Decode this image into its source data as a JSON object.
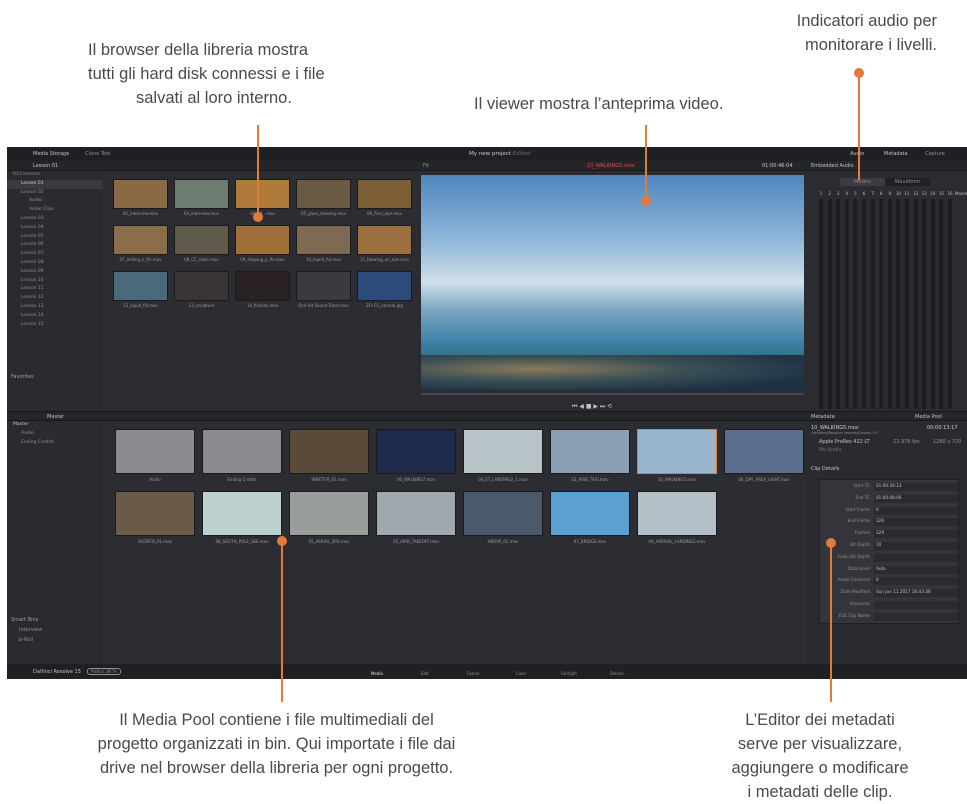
{
  "annotations": {
    "library": [
      "Il browser della libreria mostra",
      "tutti gli hard disk connessi e i file",
      "salvati al loro interno."
    ],
    "viewer": "Il viewer mostra l’anteprima video.",
    "audio": [
      "Indicatori audio per",
      "monitorare i livelli."
    ],
    "mediapool": [
      "Il Media Pool contiene i file multimediali del",
      "progetto organizzati in bin. Qui importate i file dai",
      "drive nel browser della libreria per ogni progetto."
    ],
    "metadata": [
      "L’Editor dei metadati",
      "serve per visualizzare,",
      "aggiungere o modificare",
      "i metadati delle clip."
    ]
  },
  "topbar": {
    "media_storage": "Media Storage",
    "clone_tool": "Clone Tool",
    "project": "My new project",
    "project_status": "Edited",
    "audio": "Audio",
    "metadata": "Metadata",
    "capture": "Capture"
  },
  "library": {
    "current": "Lesson 01",
    "tree": [
      "R15 lessons",
      "Lesson 01",
      "Lesson 02",
      "Audio",
      "Video Clips",
      "Lesson 03",
      "Lesson 04",
      "Lesson 05",
      "Lesson 06",
      "Lesson 07",
      "Lesson 08",
      "Lesson 09",
      "Lesson 10",
      "Lesson 11",
      "Lesson 12",
      "Lesson 13",
      "Lesson 14",
      "Lesson 15"
    ],
    "favorites": "Favorites",
    "clips": [
      "02_interview.mov",
      "03_interview.mov",
      "04_ad...mov",
      "05_glass_blowing.mov",
      "06_final_eye.mov",
      "07_milling_o_fin.mov",
      "08_CC_roots.mov",
      "09_shaping_p_fin.mov",
      "10_liquid_ful.mov",
      "11_blowing_on_eye.mov",
      "12_liquid_fill.mov",
      "13_sculpture",
      "14_finalize.mov",
      "One Hit Sound Track.mov",
      "ZFI-CC_normal.jpg"
    ]
  },
  "viewer": {
    "clip_name": "10_WALKING5.mov",
    "timecode": "01:00:46:04",
    "zoom": "Fit"
  },
  "audio_panel": {
    "title": "Embedded Audio",
    "tab_meters": "Meters",
    "tab_waveform": "Waveform",
    "channels": [
      "1",
      "2",
      "3",
      "4",
      "5",
      "6",
      "7",
      "8",
      "9",
      "10",
      "11",
      "12",
      "13",
      "14",
      "15",
      "16"
    ],
    "monitor": "Monitor"
  },
  "mediapool": {
    "bin": "Master",
    "bins": [
      "Master",
      "Audio",
      "Ending Credits"
    ],
    "smart_bins": "Smart Bins",
    "smart_items": [
      "Interview",
      "b-Roll"
    ],
    "clips": [
      "Audio",
      "Ending Credits",
      "INNETT-B_01.mov",
      "06_WALKING7.mov",
      "04_ET_LANDING2_1.mov",
      "03_AIRB_TAXI.mov",
      "10_WALKING5.mov",
      "06_DAY_AREA_LIGHT.mov",
      "SCENT-B_01.mov",
      "08_SOUTH_POLE_SEE.mov",
      "05_AERIAL_SRS.mov",
      "02_AIRB_TAKEOFF.mov",
      "ABOVE_01.mov",
      "07_BRIDGE.mov",
      "09_ARRIVAL_LANDING2.mov"
    ]
  },
  "metadata_panel": {
    "title": "Metadata",
    "mediapool": "Media Pool",
    "clip": "10_WALKING5.mov",
    "duration": "00:00:13:17",
    "path": "/Volumes/Resolve Lessons/Lesson 01",
    "codec": "Apple ProRes 422 LT",
    "fps": "23.976 fps",
    "res": "1280 x 720",
    "no_audio": "No Audio",
    "section": "Clip Details",
    "fields": [
      [
        "Start TC",
        "01:00:34:13"
      ],
      [
        "End TC",
        "01:00:48:06"
      ],
      [
        "Start Frame",
        "0"
      ],
      [
        "End Frame",
        "326"
      ],
      [
        "Frames",
        "329"
      ],
      [
        "Bit Depth",
        "10"
      ],
      [
        "Audio Bit Depth",
        ""
      ],
      [
        "Data Level",
        "Auto"
      ],
      [
        "Audio Channels",
        "0"
      ],
      [
        "Date Modified",
        "Sun Jun 11 2017 16:43:36"
      ],
      [
        "Keywords",
        ""
      ],
      [
        "EDL Clip Name",
        ""
      ]
    ]
  },
  "bottombar": {
    "app": "DaVinci Resolve 15",
    "beta": "PUBLIC BETA",
    "pages": [
      "Media",
      "Edit",
      "Fusion",
      "Color",
      "Fairlight",
      "Deliver"
    ]
  }
}
